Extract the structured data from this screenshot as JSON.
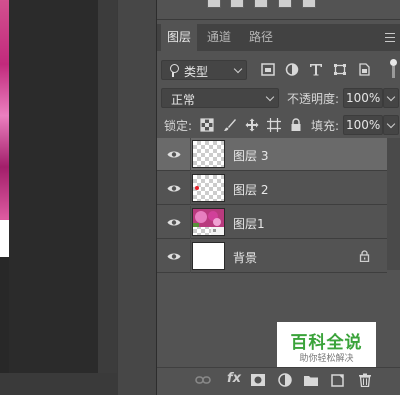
{
  "panel": {
    "tabs": [
      {
        "label": "图层"
      },
      {
        "label": "通道"
      },
      {
        "label": "路径"
      }
    ]
  },
  "filter": {
    "kind_label": "类型",
    "icons": [
      "pixel-filter-icon",
      "adjustment-filter-icon",
      "type-filter-icon",
      "shape-filter-icon",
      "smart-object-filter-icon"
    ]
  },
  "blend": {
    "mode_label": "正常",
    "opacity_label": "不透明度:",
    "opacity_value": "100%"
  },
  "lock": {
    "label": "锁定:",
    "fill_label": "填充:",
    "fill_value": "100%"
  },
  "layers": [
    {
      "name": "图层 3",
      "selected": true,
      "thumb": "transparent"
    },
    {
      "name": "图层 2",
      "selected": false,
      "thumb": "transparent-red-dot"
    },
    {
      "name": "图层1",
      "selected": false,
      "thumb": "flower-photo"
    },
    {
      "name": "背景",
      "selected": false,
      "thumb": "white",
      "locked": true
    }
  ],
  "watermark": {
    "title": "百科全说",
    "subtitle": "助你轻松解决"
  },
  "bottom_bar": {
    "fx_label": "fx"
  },
  "colors": {
    "panel_bg": "#535353",
    "tab_bar_bg": "#424242",
    "selected_row": "#6a6a6a",
    "canvas_bg": "#282828",
    "watermark_green": "#3aa33a"
  }
}
